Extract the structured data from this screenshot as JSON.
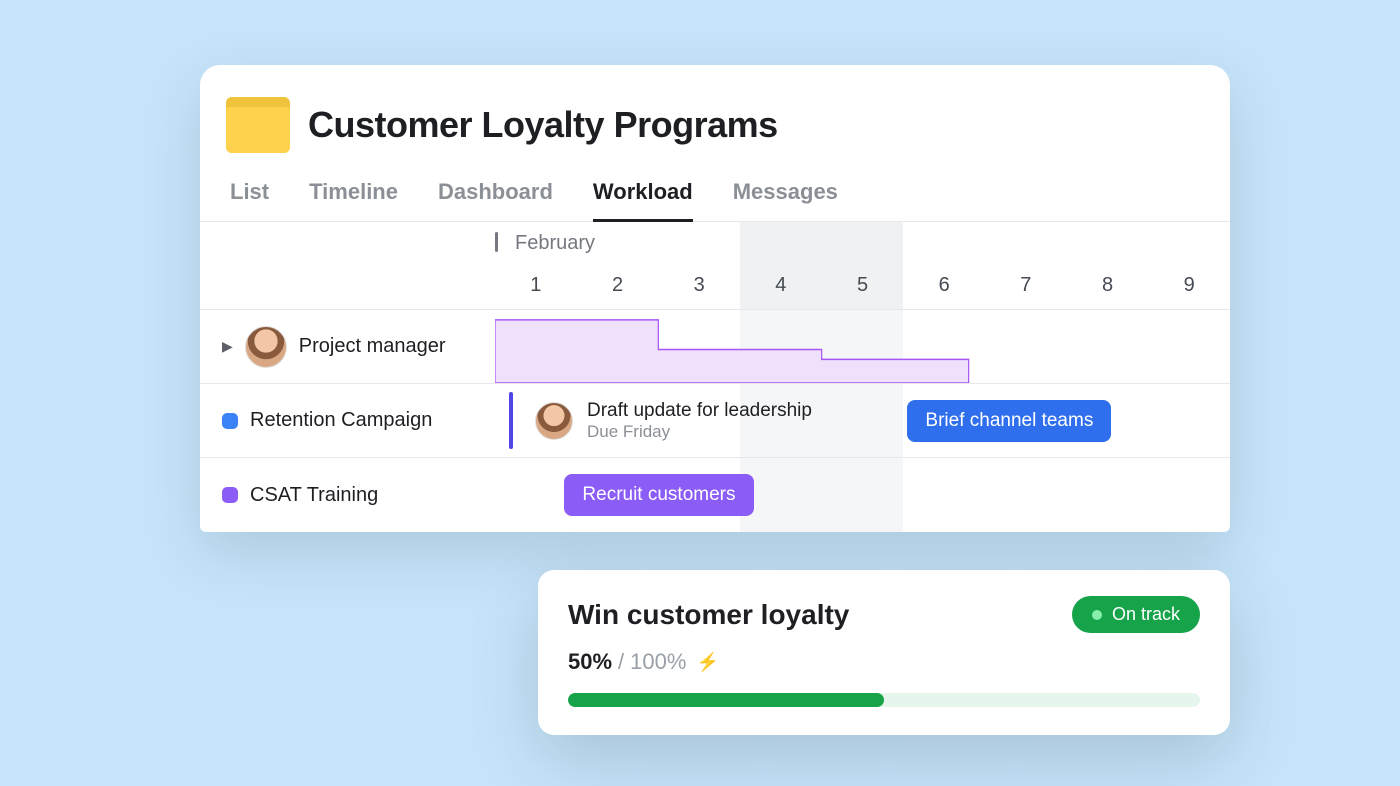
{
  "header": {
    "title": "Customer Loyalty Programs"
  },
  "tabs": [
    {
      "label": "List",
      "active": false
    },
    {
      "label": "Timeline",
      "active": false
    },
    {
      "label": "Dashboard",
      "active": false
    },
    {
      "label": "Workload",
      "active": true
    },
    {
      "label": "Messages",
      "active": false
    }
  ],
  "timeline": {
    "month": "February",
    "days": [
      "1",
      "2",
      "3",
      "4",
      "5",
      "6",
      "7",
      "8",
      "9"
    ],
    "weekend_cols": [
      4,
      5
    ]
  },
  "rows": {
    "manager": {
      "label": "Project manager"
    },
    "retention": {
      "color": "blue",
      "label": "Retention Campaign",
      "task": {
        "title": "Draft update for leadership",
        "due": "Due Friday"
      },
      "brief_label": "Brief channel teams"
    },
    "csat": {
      "color": "purple",
      "label": "CSAT Training",
      "recruit_label": "Recruit customers"
    }
  },
  "goal": {
    "title": "Win customer loyalty",
    "status": "On track",
    "current": "50%",
    "separator": "/",
    "total": "100%",
    "progress_pct": 50
  }
}
